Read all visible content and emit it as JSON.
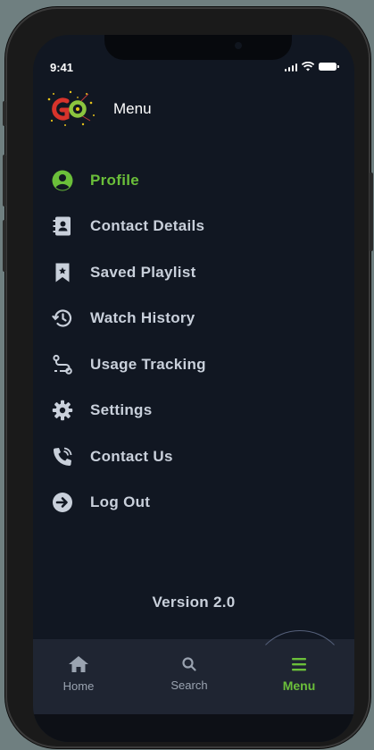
{
  "status_bar": {
    "time": "9:41"
  },
  "header": {
    "logo_text": "GO",
    "title": "Menu"
  },
  "menu": {
    "items": [
      {
        "label": "Profile",
        "icon": "user-circle-icon",
        "active": true
      },
      {
        "label": "Contact Details",
        "icon": "contact-book-icon",
        "active": false
      },
      {
        "label": "Saved Playlist",
        "icon": "bookmark-icon",
        "active": false
      },
      {
        "label": "Watch History",
        "icon": "history-icon",
        "active": false
      },
      {
        "label": "Usage Tracking",
        "icon": "route-icon",
        "active": false
      },
      {
        "label": "Settings",
        "icon": "gear-icon",
        "active": false
      },
      {
        "label": "Contact Us",
        "icon": "phone-call-icon",
        "active": false
      },
      {
        "label": "Log Out",
        "icon": "logout-icon",
        "active": false
      }
    ]
  },
  "version": "Version 2.0",
  "tab_bar": {
    "tabs": [
      {
        "label": "Home",
        "icon": "home-icon",
        "active": false
      },
      {
        "label": "Search",
        "icon": "search-icon",
        "active": false
      },
      {
        "label": "Menu",
        "icon": "hamburger-icon",
        "active": true
      }
    ]
  },
  "colors": {
    "accent": "#6bbf3a",
    "background": "#111722",
    "menu_text": "#c9d0db",
    "tab_bar": "#1f2532"
  }
}
